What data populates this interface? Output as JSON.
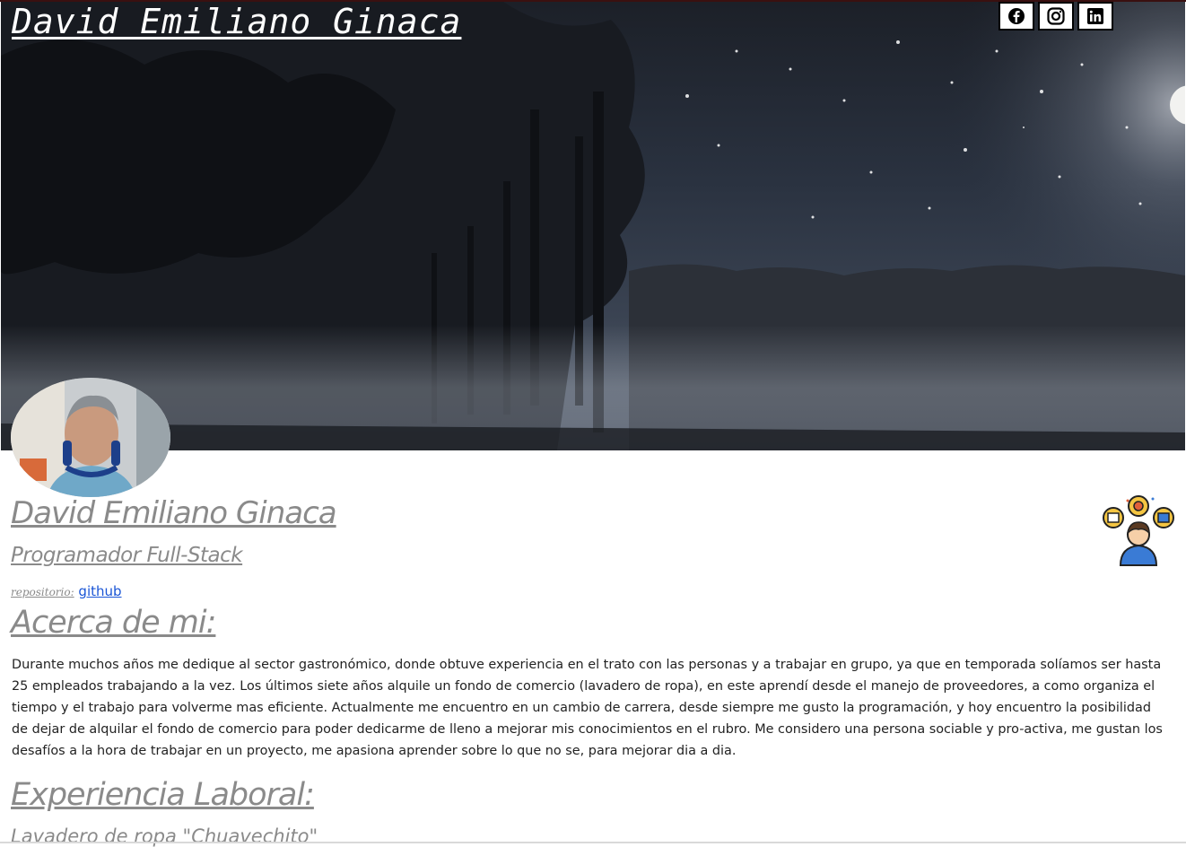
{
  "header": {
    "site_title": "David Emiliano Ginaca",
    "social": [
      {
        "icon": "facebook-icon"
      },
      {
        "icon": "instagram-icon"
      },
      {
        "icon": "linkedin-icon"
      }
    ]
  },
  "profile": {
    "name": "David Emiliano Ginaca",
    "role": "Programador Full-Stack",
    "repo_label": "repositorio:",
    "repo_link": "github"
  },
  "about": {
    "title": "Acerca de mi:",
    "text": "Durante muchos años me dedique al sector gastronómico, donde obtuve experiencia en el trato con las personas y a trabajar en grupo, ya que en temporada solíamos ser hasta 25 empleados trabajando a la vez. Los últimos siete años alquile un fondo de comercio (lavadero de ropa), en este aprendí desde el manejo de proveedores, a como organiza el tiempo y el trabajo para volverme mas eficiente. Actualmente me encuentro en un cambio de carrera, desde siempre me gusto la programación, y hoy encuentro la posibilidad de dejar de alquilar el fondo de comercio para poder dedicarme de lleno a mejorar mis conocimientos en el rubro. Me considero una persona sociable y pro-activa, me gustan los desafíos a la hora de trabajar en un proyecto, me apasiona aprender sobre lo que no se, para mejorar dia a dia."
  },
  "experience": {
    "title": "Experiencia Laboral:",
    "first_job": "Lavadero de ropa \"Chuavechito\""
  },
  "colors": {
    "heading_gray": "#8a8a8a",
    "link_blue": "#1a55d6",
    "body_text": "#222222"
  }
}
